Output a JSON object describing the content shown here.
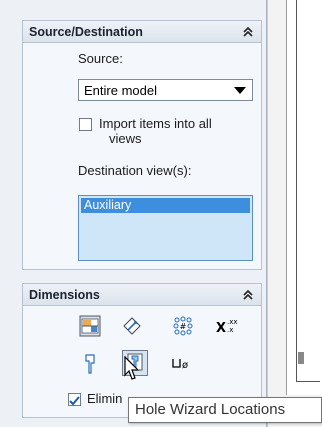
{
  "source_group": {
    "title": "Source/Destination",
    "source_label": "Source:",
    "source_value": "Entire model",
    "import_checkbox_label_line1": "Import items into all",
    "import_checkbox_label_line2": "views",
    "import_checked": false,
    "destination_label": "Destination view(s):",
    "destination_items": [
      "Auxiliary"
    ]
  },
  "dimensions_group": {
    "title": "Dimensions",
    "eliminate_label_visible": "Elimin",
    "eliminate_checked": true,
    "icons": [
      "marked-for-drawing-icon",
      "not-marked-for-drawing-icon",
      "instance-count-icon",
      "tolerance-dimension-icon",
      "hole-wizard-profiles-icon",
      "hole-wizard-locations-icon",
      "hole-callout-icon"
    ]
  },
  "tooltip": {
    "text": "Hole Wizard Locations"
  },
  "colors": {
    "accent": "#3e8ede",
    "listbox_bg": "#cfe6f8",
    "panel_bg": "#edf1f6"
  }
}
